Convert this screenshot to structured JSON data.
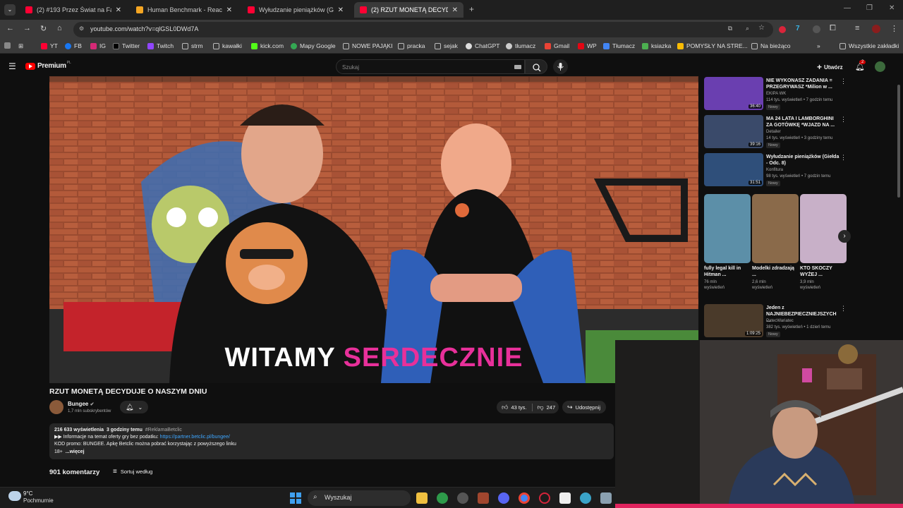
{
  "browser": {
    "tabs": [
      {
        "label": "(2) #193 Przez Świat na Fazie - ",
        "active": false
      },
      {
        "label": "Human Benchmark - Reaction T",
        "active": false
      },
      {
        "label": "Wyłudzanie pieniążków (Giełda",
        "active": false
      },
      {
        "label": "(2) RZUT MONETĄ DECYDUJE O",
        "active": true
      }
    ],
    "new_tab": "+",
    "url": "youtube.com/watch?v=qlGSL0DWd7A",
    "bookmarks": [
      "YT",
      "FB",
      "IG",
      "Twitter",
      "Twitch",
      "strm",
      "kawałki",
      "kick.com",
      "Mapy Google",
      "NOWE PAJĄKI",
      "pracka",
      "sejak",
      "ChatGPT",
      "tłumacz",
      "Gmail",
      "WP",
      "Tłumacz",
      "ksiazka",
      "POMYSŁY NA STRE...",
      "Na bieżąco"
    ],
    "bookmarks_more": "»",
    "all_bookmarks": "Wszystkie zakładki"
  },
  "youtube": {
    "logo": "Premium",
    "logo_region": "PL",
    "search_placeholder": "Szukaj",
    "create_label": "Utwórz",
    "notif_count": "2",
    "video_overlay_left": "WITAMY",
    "video_overlay_right": "SERDECZNIE",
    "video_title": "RZUT MONETĄ DECYDUJE O NASZYM DNIU",
    "channel_name": "Bungee",
    "channel_subs": "1,7 mln subskrybentów",
    "likes": "43 tys.",
    "dislikes": "247",
    "share": "Udostępnij",
    "desc_line1_views": "216 633 wyświetlenia",
    "desc_line1_time": "3 godziny temu",
    "desc_line1_tag": "#ReklamaBetclic",
    "desc_line2_text": "▶▶ Informacje na temat oferty gry bez podatku: ",
    "desc_line2_link": "https://partner.betclic.pl/bungee/",
    "desc_line3": "KOD promo: BUNGEE. Apkę Betclic można pobrać korzystając z powyższego linku",
    "desc_line4_a": "18+",
    "desc_line4_b": "...więcej",
    "comments_count": "901 komentarzy",
    "sort_label": "Sortuj według"
  },
  "sidebar": {
    "recs": [
      {
        "title": "NIE WYKONASZ ZADANIA = PRZEGRYWASZ *Milion w ...",
        "channel": "EKIPA WK",
        "meta": "114 tys. wyświetleń • 7 godzin temu",
        "badge": "Nowy",
        "duration": "36:40",
        "thumb_color": "#6a3fb0"
      },
      {
        "title": "MA 24 LATA I LAMBORGHINI ZA GOTÓWKĘ *WJAZD NA ...",
        "channel": "Detailer",
        "meta": "14 tys. wyświetleń • 3 godziny temu",
        "badge": "Nowy",
        "duration": "39:16",
        "thumb_color": "#3a4a6a"
      },
      {
        "title": "Wyłudzanie pieniążków (Giełda - Odc. 8)",
        "channel": "Konfitura",
        "meta": "98 tys. wyświetleń • 7 godzin temu",
        "badge": "Nowy",
        "duration": "31:51",
        "thumb_color": "#2f4f7a"
      },
      {
        "title": "Jeden z NAJNIEBEZPIECZNIEJSZYCH ...",
        "channel": "PatecWariatec",
        "meta": "382 tys. wyświetleń • 1 dzień temu",
        "badge": "Nowy",
        "duration": "1:09:25",
        "thumb_color": "#4a3a2a"
      }
    ],
    "shorts": [
      {
        "title": "fully legal kill in Hitman ...",
        "views": "76 mln",
        "views2": "wyświetleń",
        "color": "#5c8fa8"
      },
      {
        "title": "Modelki zdradzają ...",
        "views": "2,6 mln",
        "views2": "wyświetleń",
        "color": "#8a6a4a"
      },
      {
        "title": "KTO SKOCZY WYŻEJ ...",
        "views": "3,9 mln",
        "views2": "wyświetleń",
        "color": "#c8b0c8"
      }
    ]
  },
  "taskbar": {
    "weather_temp": "9°C",
    "weather_desc": "Pochmurnie",
    "search": "Wyszukaj"
  },
  "colors": {
    "yt_red": "#ff0000",
    "pink": "#e8309a",
    "link": "#3ea6ff"
  }
}
